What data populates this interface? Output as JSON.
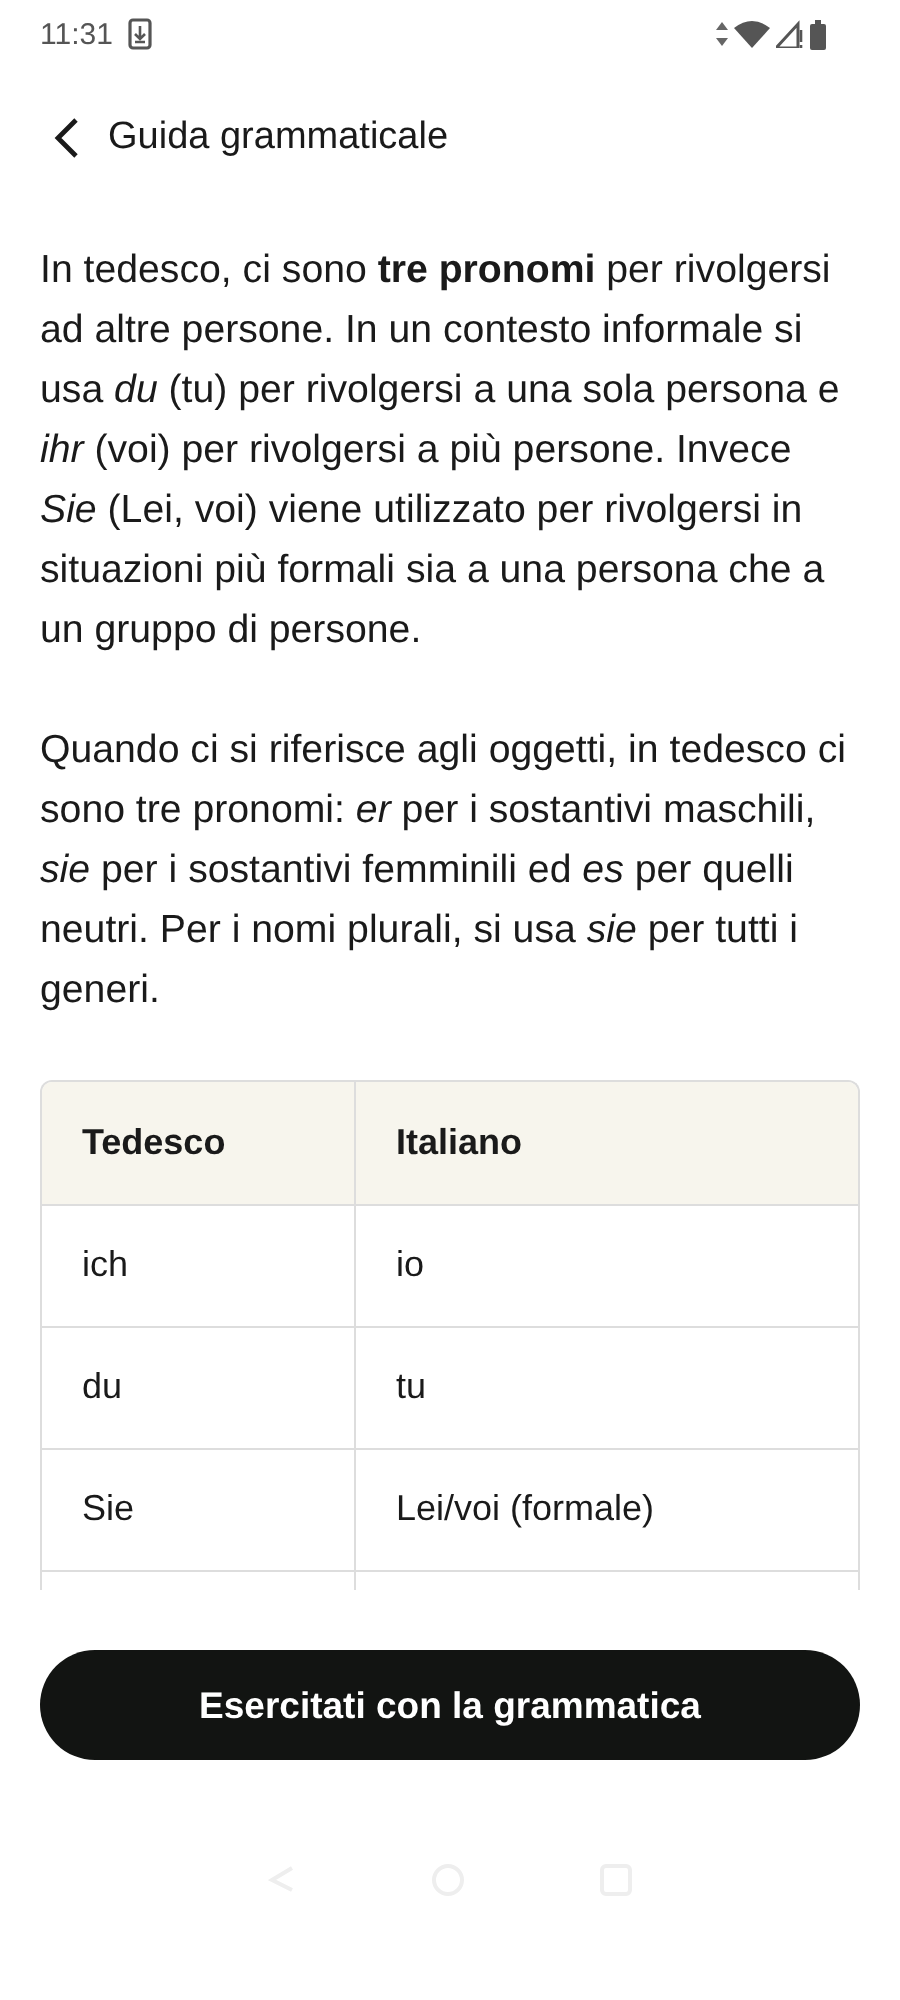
{
  "status_bar": {
    "time": "11:31"
  },
  "header": {
    "title": "Guida grammaticale"
  },
  "paragraphs": [
    "In tedesco, ci sono **tre pronomi** per rivolgersi ad altre persone. In un contesto informale si usa *du* (tu) per rivolgersi a una sola persona e *ihr* (voi) per rivolgersi a più persone. Invece *Sie* (Lei, voi) viene utilizzato per rivolgersi in situazioni più formali sia a una persona che a un gruppo di persone.",
    "Quando ci si riferisce agli oggetti, in tedesco ci sono tre pronomi: *er* per i sostantivi maschili, *sie* per i sostantivi femminili ed *es* per quelli neutri. Per i nomi plurali, si usa *sie* per tutti i generi."
  ],
  "table": {
    "columns": [
      "Tedesco",
      "Italiano"
    ],
    "rows": [
      [
        "ich",
        "io"
      ],
      [
        "du",
        "tu"
      ],
      [
        "Sie",
        "Lei/voi (formale)"
      ]
    ]
  },
  "button": {
    "label": "Esercitati con la grammatica"
  }
}
